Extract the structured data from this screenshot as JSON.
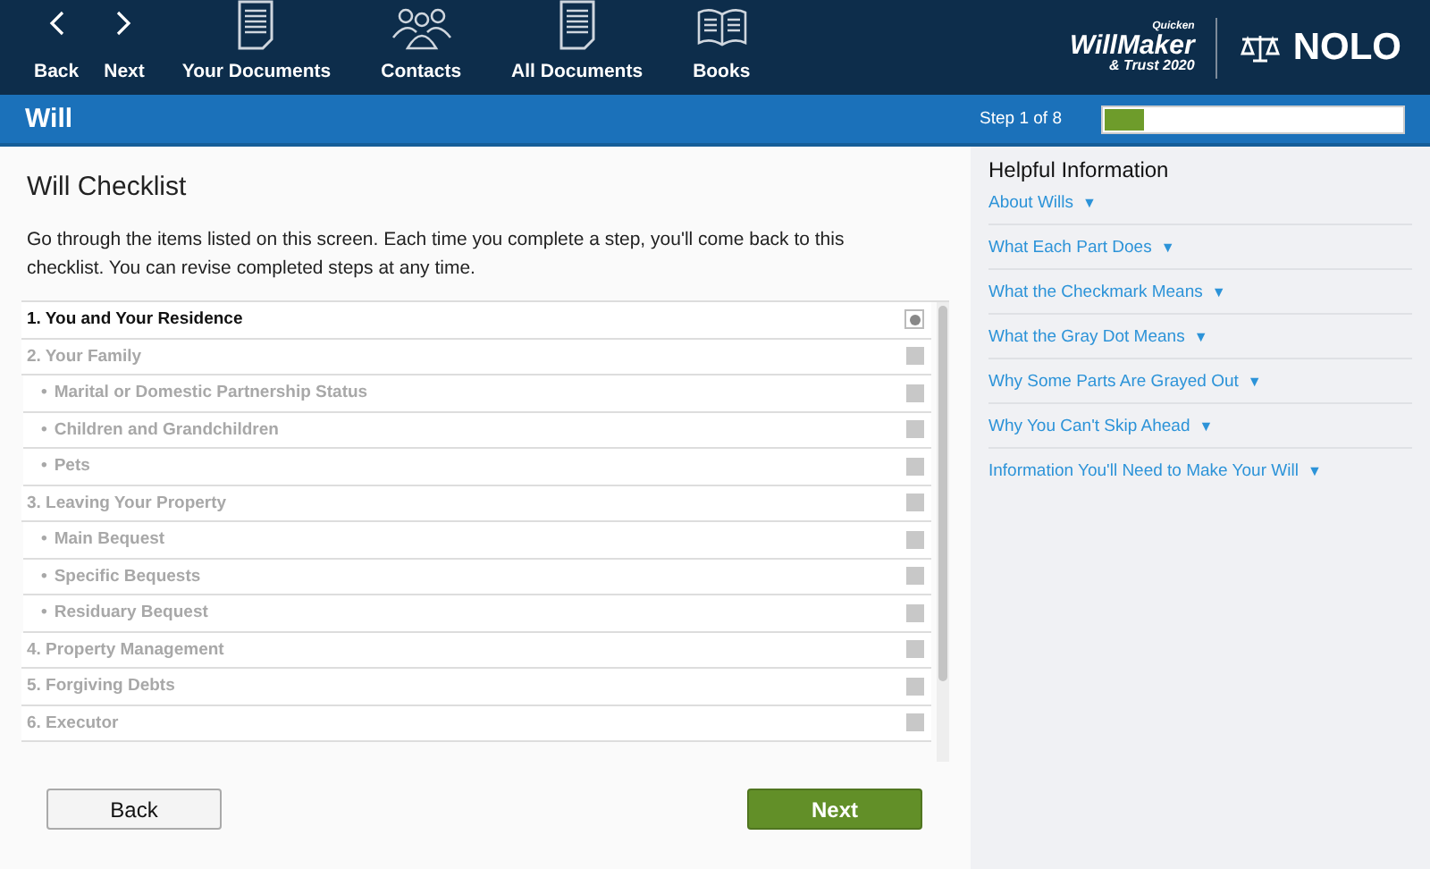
{
  "toolbar": {
    "items": [
      {
        "kind": "back",
        "label": "Back"
      },
      {
        "kind": "next",
        "label": "Next"
      },
      {
        "kind": "document",
        "label": "Your Documents"
      },
      {
        "kind": "contacts",
        "label": "Contacts"
      },
      {
        "kind": "document",
        "label": "All Documents"
      },
      {
        "kind": "book",
        "label": "Books"
      }
    ]
  },
  "logo": {
    "brand_small": "Quicken",
    "brand": "WillMaker",
    "edition": "& Trust 2020",
    "publisher": "NOLO"
  },
  "header": {
    "title": "Will",
    "step": "Step 1 of 8",
    "level": 0.13
  },
  "checklist": {
    "title": "Will Checklist",
    "intro": "Go through the items listed on this screen. Each time you complete a step, you'll come back to this checklist. You can revise completed steps at any time.",
    "items": [
      {
        "kind": "section",
        "label": "1. You and Your Residence",
        "current": true
      },
      {
        "kind": "section",
        "label": "2. Your Family",
        "current": false
      },
      {
        "kind": "sub",
        "bullet": "•",
        "label": "Marital or Domestic Partnership Status",
        "current": false
      },
      {
        "kind": "sub",
        "bullet": "•",
        "label": "Children and Grandchildren",
        "current": false
      },
      {
        "kind": "sub",
        "bullet": "•",
        "label": "Pets",
        "current": false
      },
      {
        "kind": "section",
        "label": "3. Leaving Your Property",
        "current": false
      },
      {
        "kind": "sub",
        "bullet": "•",
        "label": "Main Bequest",
        "current": false
      },
      {
        "kind": "sub",
        "bullet": "•",
        "label": "Specific Bequests",
        "current": false
      },
      {
        "kind": "sub",
        "bullet": "•",
        "label": "Residuary Bequest",
        "current": false
      },
      {
        "kind": "section",
        "label": "4. Property Management",
        "current": false
      },
      {
        "kind": "section",
        "label": "5. Forgiving Debts",
        "current": false
      },
      {
        "kind": "section",
        "label": "6. Executor",
        "current": false
      }
    ]
  },
  "buttons": [
    {
      "kind": "secondary",
      "label": "Back"
    },
    {
      "kind": "primary",
      "label": "Next"
    }
  ],
  "help": {
    "title": "Helpful Information",
    "caret": "▼",
    "links": [
      "About Wills",
      "What Each Part Does",
      "What the Checkmark Means",
      "What the Gray Dot Means",
      "Why Some Parts Are Grayed Out",
      "Why You Can't Skip Ahead",
      "Information You'll Need to Make Your Will"
    ]
  }
}
